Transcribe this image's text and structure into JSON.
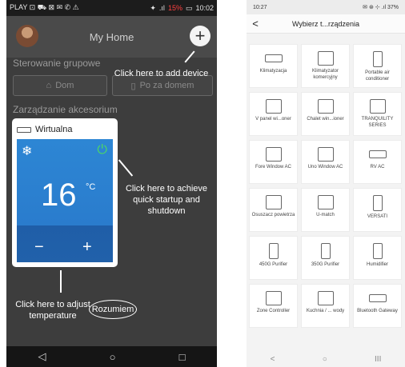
{
  "left": {
    "statusbar": {
      "left": "PLAY ⊡ ⛟ ⊠ ✉ ✆ ⚠",
      "battery": "15%",
      "time": "10:02"
    },
    "header": {
      "title": "My Home",
      "add_glyph": "+"
    },
    "group_control": {
      "title": "Sterowanie grupowe",
      "btn_home": "Dom",
      "btn_away": "Po za domem"
    },
    "accessories_title": "Zarządzanie akcesorium",
    "card": {
      "name": "Wirtualna",
      "temp": "16",
      "unit": "°C",
      "minus": "−",
      "plus": "+"
    },
    "hints": {
      "add_device": "Click here to add device",
      "quick_start": "Click here to achieve quick startup and shutdown",
      "adjust_temp": "Click here to adjust temperature"
    },
    "ok_label": "Rozumiem",
    "nav": {
      "back": "◁",
      "home": "○",
      "recent": "□"
    }
  },
  "right": {
    "statusbar": {
      "time": "10:27",
      "icons": "✉ ⊛ ⊹ .ıl 37%"
    },
    "header": {
      "back": "<",
      "title": "Wybierz t...rządzenia"
    },
    "tiles": [
      {
        "label": "Klimatyzacja",
        "icon": "ac-wall-icon"
      },
      {
        "label": "Klimatyzator komercyjny",
        "icon": "commercial-ac-icon"
      },
      {
        "label": "Portable air conditioner",
        "icon": "portable-ac-icon"
      },
      {
        "label": "V panel wi...oner",
        "icon": "v-panel-icon"
      },
      {
        "label": "Chalet win...ioner",
        "icon": "chalet-icon"
      },
      {
        "label": "TRANQUILITY SERIES",
        "icon": "tranquility-icon"
      },
      {
        "label": "Fore Window AC",
        "icon": "fore-window-icon"
      },
      {
        "label": "Uno Window AC",
        "icon": "uno-window-icon"
      },
      {
        "label": "RV AC",
        "icon": "rv-ac-icon"
      },
      {
        "label": "Osuszacz powietrza",
        "icon": "dehumidifier-icon"
      },
      {
        "label": "U-match",
        "icon": "umatch-icon"
      },
      {
        "label": "VERSATI",
        "icon": "versati-icon"
      },
      {
        "label": "450G Purifier",
        "icon": "purifier-450-icon"
      },
      {
        "label": "350G Purifier",
        "icon": "purifier-350-icon"
      },
      {
        "label": "Humidifier",
        "icon": "humidifier-icon"
      },
      {
        "label": "Zone Controller",
        "icon": "zone-controller-icon"
      },
      {
        "label": "Kuchnia / ... wody",
        "icon": "kitchen-icon"
      },
      {
        "label": "Bluetooth Gateway",
        "icon": "gateway-icon"
      }
    ],
    "nav": {
      "back": "<",
      "home": "○",
      "recent": "III"
    }
  },
  "colors": {
    "panel_blue": "#2a7ccd",
    "power_green": "#4cd964",
    "battery_red": "#ff4040",
    "dark_bg": "#3d3d3d"
  }
}
